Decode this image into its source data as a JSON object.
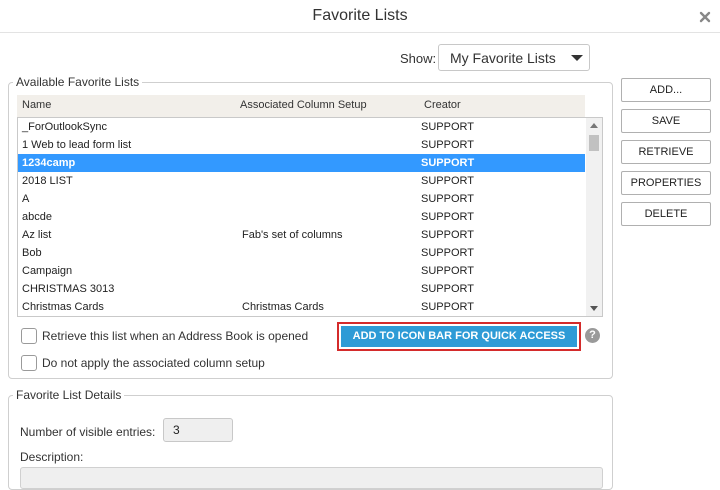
{
  "dialog": {
    "title": "Favorite Lists"
  },
  "icons": {
    "close": "close-icon",
    "help": "help-icon"
  },
  "show": {
    "label": "Show:",
    "selected": "My Favorite Lists"
  },
  "available": {
    "legend": "Available Favorite Lists",
    "columns": [
      "Name",
      "Associated Column Setup",
      "Creator"
    ],
    "rows": [
      {
        "name": "_ForOutlookSync",
        "setup": "",
        "creator": "SUPPORT"
      },
      {
        "name": "1 Web to lead form list",
        "setup": "",
        "creator": "SUPPORT"
      },
      {
        "name": "1234camp",
        "setup": "",
        "creator": "SUPPORT",
        "selected": true
      },
      {
        "name": "2018 LIST",
        "setup": "",
        "creator": "SUPPORT"
      },
      {
        "name": "A",
        "setup": "",
        "creator": "SUPPORT"
      },
      {
        "name": "abcde",
        "setup": "",
        "creator": "SUPPORT"
      },
      {
        "name": "Az list",
        "setup": "Fab's set of columns",
        "creator": "SUPPORT"
      },
      {
        "name": "Bob",
        "setup": "",
        "creator": "SUPPORT"
      },
      {
        "name": "Campaign",
        "setup": "",
        "creator": "SUPPORT"
      },
      {
        "name": "CHRISTMAS 3013",
        "setup": "",
        "creator": "SUPPORT"
      },
      {
        "name": "Christmas Cards",
        "setup": "Christmas Cards",
        "creator": "SUPPORT"
      }
    ],
    "retrieve_label": "Retrieve this list when an Address Book is opened",
    "no_apply_label": "Do not apply the associated column setup",
    "quick_access_label": "ADD TO ICON BAR FOR QUICK ACCESS",
    "help_glyph": "?"
  },
  "side_buttons": [
    "ADD...",
    "SAVE",
    "RETRIEVE",
    "PROPERTIES",
    "DELETE"
  ],
  "details": {
    "legend": "Favorite List Details",
    "visible_entries_label": "Number of visible entries:",
    "visible_entries_value": "3",
    "description_label": "Description:"
  },
  "colors": {
    "selection": "#3399ff",
    "accent_button": "#2e9bd6",
    "highlight_border": "#d42b2b"
  }
}
